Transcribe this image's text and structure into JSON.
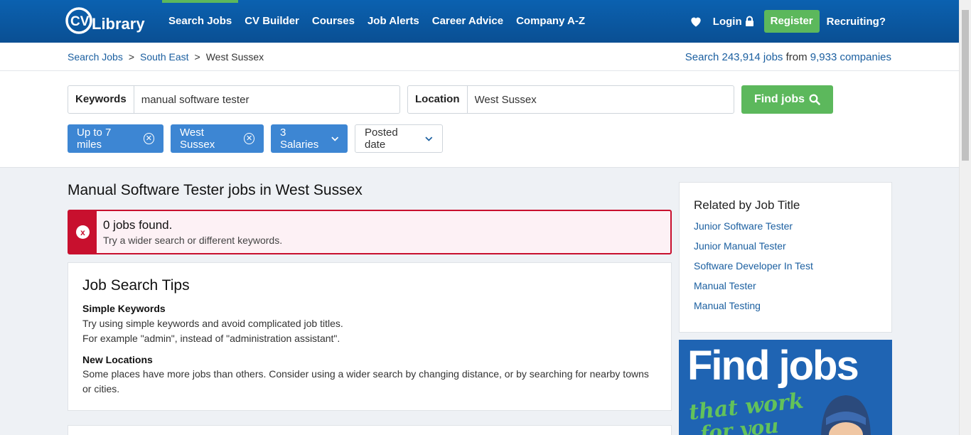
{
  "header": {
    "logo_text": "CVLibrary",
    "nav": [
      "Search Jobs",
      "CV Builder",
      "Courses",
      "Job Alerts",
      "Career Advice",
      "Company A-Z"
    ],
    "login": "Login",
    "register": "Register",
    "recruiting": "Recruiting?"
  },
  "breadcrumb": {
    "items": [
      "Search Jobs",
      "South East",
      "West Sussex"
    ],
    "separator": ">"
  },
  "stats": {
    "prefix": "Search ",
    "jobs": "243,914 jobs",
    "middle": " from ",
    "companies": "9,933 companies"
  },
  "search": {
    "keywords_label": "Keywords",
    "keywords_value": "manual software tester",
    "location_label": "Location",
    "location_value": "West Sussex",
    "find_button": "Find jobs"
  },
  "filters": {
    "distance": "Up to 7 miles",
    "location": "West Sussex",
    "salaries": "3 Salaries",
    "posted": "Posted date"
  },
  "main": {
    "title": "Manual Software Tester jobs in West Sussex",
    "alert_heading": "0 jobs found.",
    "alert_text": "Try a wider search or different keywords."
  },
  "tips": {
    "title": "Job Search Tips",
    "sections": [
      {
        "heading": "Simple Keywords",
        "lines": [
          "Try using simple keywords and avoid complicated job titles.",
          "For example \"admin\", instead of \"administration assistant\"."
        ]
      },
      {
        "heading": "New Locations",
        "lines": [
          "Some places have more jobs than others. Consider using a wider search by changing distance, or by searching for nearby towns or cities."
        ]
      }
    ]
  },
  "related": {
    "title": "Related by Job Title",
    "links": [
      "Junior Software Tester",
      "Junior Manual Tester",
      "Software Developer In Test",
      "Manual Tester",
      "Manual Testing"
    ]
  },
  "ad": {
    "headline": "Find jobs",
    "script_line1": "that work",
    "script_line2": "for you"
  },
  "colors": {
    "header_blue": "#0a5aa5",
    "green": "#5cb85c",
    "chip_blue": "#3d86d3",
    "alert_red": "#c8102e",
    "link_blue": "#1b5fa0"
  }
}
